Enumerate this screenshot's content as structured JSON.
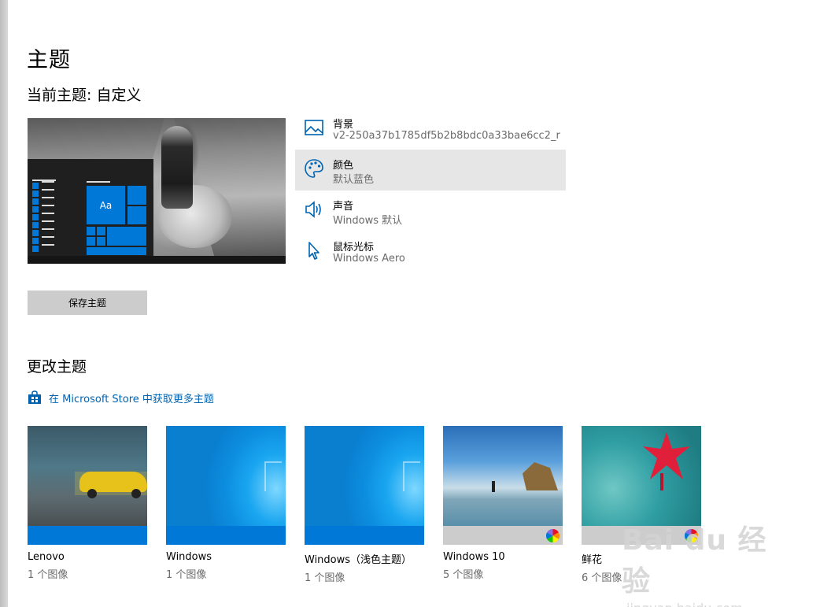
{
  "page": {
    "title": "主题",
    "current_theme": "当前主题: 自定义"
  },
  "preview": {
    "tile_label": "Aa"
  },
  "settings": [
    {
      "name": "背景",
      "value": "v2-250a37b1785df5b2b8bdc0a33bae6cc2_r",
      "icon": "picture-icon"
    },
    {
      "name": "颜色",
      "value": "默认蓝色",
      "icon": "palette-icon"
    },
    {
      "name": "声音",
      "value": "Windows 默认",
      "icon": "speaker-icon"
    },
    {
      "name": "鼠标光标",
      "value": "Windows Aero",
      "icon": "cursor-icon"
    }
  ],
  "save_button": "保存主题",
  "change_section": {
    "title": "更改主题",
    "store_link": "在 Microsoft Store 中获取更多主题"
  },
  "themes": [
    {
      "name": "Lenovo",
      "count": "1 个图像",
      "accent": "#0078d7"
    },
    {
      "name": "Windows",
      "count": "1 个图像",
      "accent": "#0078d7"
    },
    {
      "name": "Windows（浅色主题）",
      "count": "1 个图像",
      "accent": "#0078d7"
    },
    {
      "name": "Windows 10",
      "count": "5 个图像",
      "accent": "#cccccc"
    },
    {
      "name": "鲜花",
      "count": "6 个图像",
      "accent": "#cccccc"
    }
  ],
  "watermark": {
    "logo_text": "Bai du 经验",
    "url": "jingyan.baidu.com"
  },
  "colors": {
    "accent": "#0078d7",
    "link": "#0063b1",
    "selected_bg": "#e6e6e6",
    "button_bg": "#cccccc"
  }
}
